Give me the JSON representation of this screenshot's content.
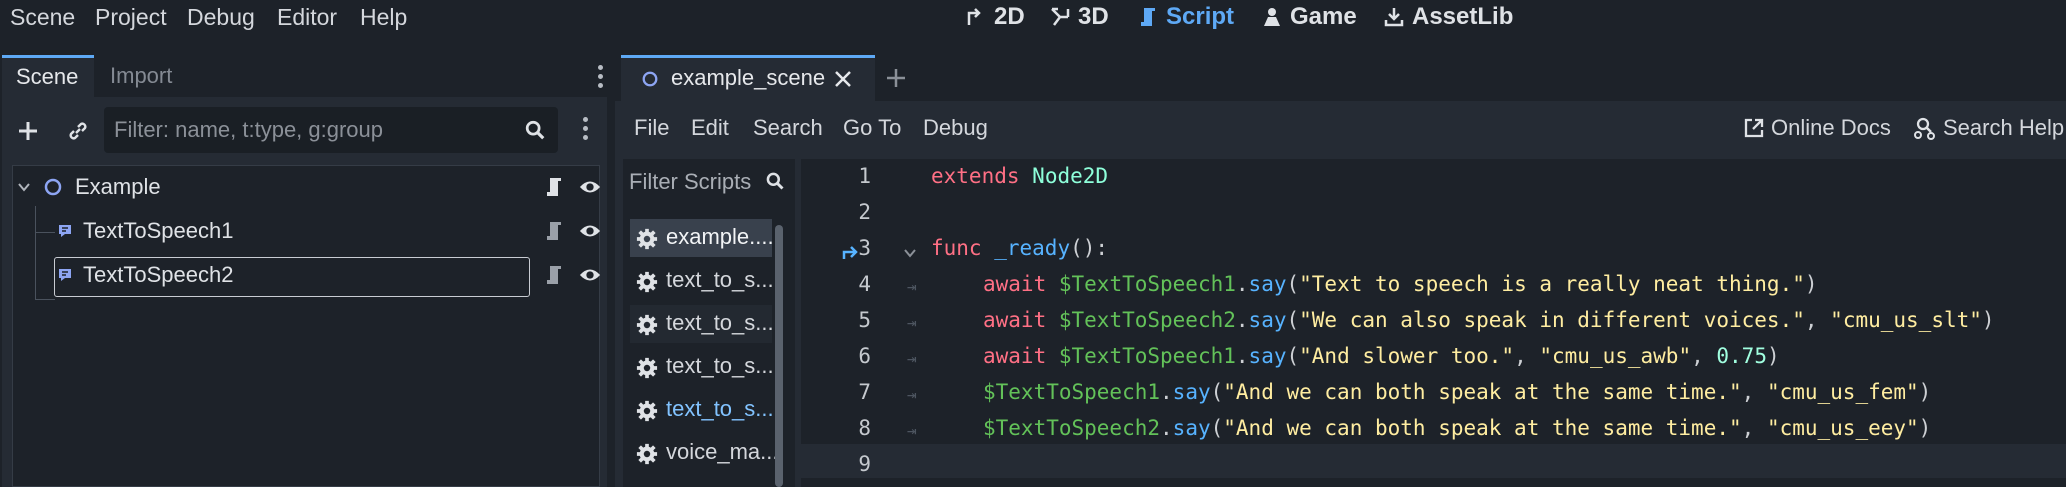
{
  "menu": [
    "Scene",
    "Project",
    "Debug",
    "Editor",
    "Help"
  ],
  "workspaces": [
    {
      "label": "2D",
      "icon": "2d-icon"
    },
    {
      "label": "3D",
      "icon": "3d-icon"
    },
    {
      "label": "Script",
      "icon": "script-icon",
      "active": true
    },
    {
      "label": "Game",
      "icon": "game-icon"
    },
    {
      "label": "AssetLib",
      "icon": "assetlib-icon"
    }
  ],
  "scene_dock": {
    "tabs": [
      "Scene",
      "Import"
    ],
    "filter_placeholder": "Filter: name, t:type, g:group",
    "nodes": [
      {
        "name": "Example",
        "type": "node2d"
      },
      {
        "name": "TextToSpeech1",
        "type": "tts"
      },
      {
        "name": "TextToSpeech2",
        "type": "tts",
        "selected": true
      }
    ]
  },
  "editor": {
    "tab": "example_scene",
    "menu": [
      "File",
      "Edit",
      "Search",
      "Go To",
      "Debug"
    ],
    "online_docs": "Online Docs",
    "search_help": "Search Help",
    "filter_scripts": "Filter Scripts",
    "scripts": [
      "example....",
      "text_to_s...",
      "text_to_s...",
      "text_to_s...",
      "text_to_s...",
      "voice_ma..."
    ]
  },
  "code": {
    "line_numbers": [
      "1",
      "2",
      "3",
      "4",
      "5",
      "6",
      "7",
      "8",
      "9"
    ],
    "l1_kw": "extends",
    "l1_type": "Node2D",
    "l3_kw": "func",
    "l3_fn": "_ready",
    "l3_rest": "():",
    "await": "await",
    "node1": "$TextToSpeech1",
    "node2": "$TextToSpeech2",
    "say": "say",
    "l4_str": "\"Text to speech is a really neat thing.\"",
    "l5_str1": "\"We can also speak in different voices.\"",
    "l5_str2": "\"cmu_us_slt\"",
    "l6_str1": "\"And slower too.\"",
    "l6_str2": "\"cmu_us_awb\"",
    "l6_num": "0.75",
    "l7_str1": "\"And we can both speak at the same time.\"",
    "l7_str2": "\"cmu_us_fem\"",
    "l8_str1": "\"And we can both speak at the same time.\"",
    "l8_str2": "\"cmu_us_eey\""
  },
  "colors": {
    "accent": "#5ea9f5",
    "keyword": "#ff7085",
    "string": "#ffeda1",
    "function": "#57b3ff",
    "node_path": "#63c259"
  }
}
